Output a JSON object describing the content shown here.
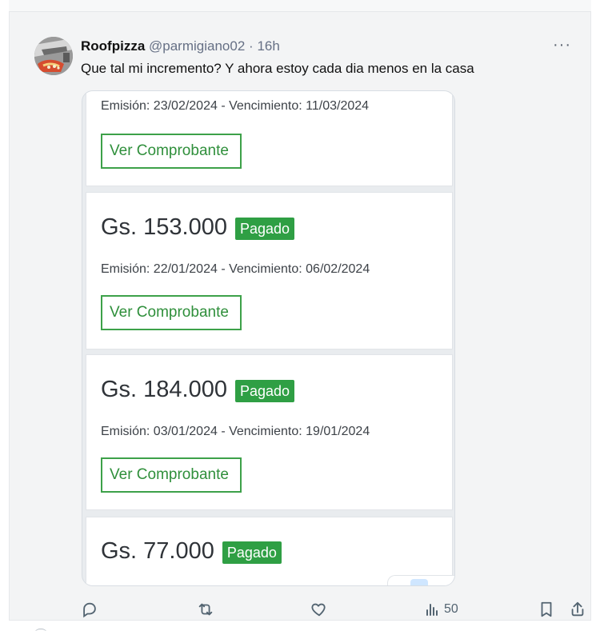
{
  "tweet": {
    "author_name": "Roofpizza",
    "author_handle": "@parmigiano02",
    "separator": "·",
    "time": "16h",
    "text": "Que tal mi incremento? Y ahora estoy cada dia menos en la casa",
    "more_icon": "more-horizontal-icon"
  },
  "media": {
    "invoices": [
      {
        "amount": "",
        "status": "",
        "dates": "Emisión: 23/02/2024 - Vencimiento: 11/03/2024",
        "button": "Ver Comprobante"
      },
      {
        "amount": "Gs. 153.000",
        "status": "Pagado",
        "dates": "Emisión: 22/01/2024 - Vencimiento: 06/02/2024",
        "button": "Ver Comprobante"
      },
      {
        "amount": "Gs. 184.000",
        "status": "Pagado",
        "dates": "Emisión: 03/01/2024 - Vencimiento: 19/01/2024",
        "button": "Ver Comprobante"
      },
      {
        "amount": "Gs. 77.000",
        "status": "Pagado",
        "dates": "",
        "button": ""
      }
    ]
  },
  "actions": {
    "views_count": "50",
    "icons": [
      "reply-icon",
      "retweet-icon",
      "like-icon",
      "views-icon",
      "bookmark-icon",
      "share-icon"
    ]
  },
  "colors": {
    "status_green": "#2f9f44",
    "button_border": "#3da149",
    "action_icon": "#536471"
  }
}
